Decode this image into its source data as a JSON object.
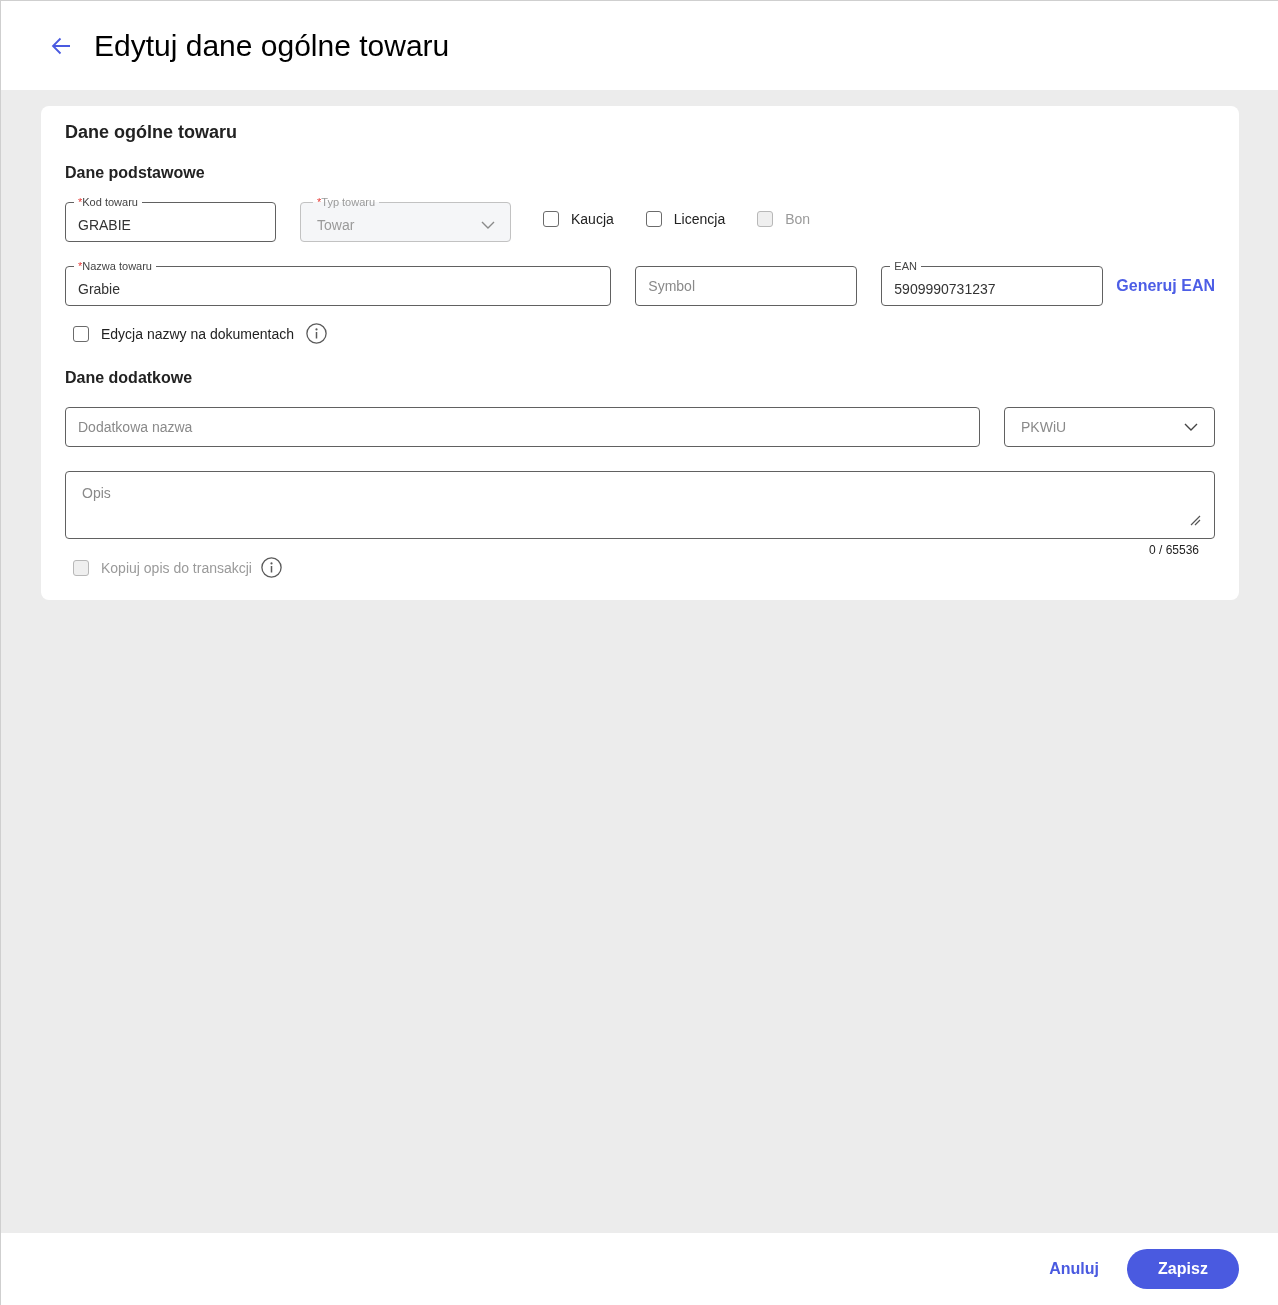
{
  "header": {
    "title": "Edytuj dane ogólne towaru"
  },
  "card": {
    "title": "Dane ogólne towaru",
    "basic": {
      "heading": "Dane podstawowe",
      "code_field": {
        "required_mark": "*",
        "label": "Kod towaru",
        "value": "GRABIE"
      },
      "type_select": {
        "required_mark": "*",
        "label": "Typ towaru",
        "value": "Towar",
        "disabled": true
      },
      "flags": [
        {
          "label": "Kaucja",
          "checked": false,
          "disabled": false
        },
        {
          "label": "Licencja",
          "checked": false,
          "disabled": false
        },
        {
          "label": "Bon",
          "checked": false,
          "disabled": true
        }
      ],
      "name_field": {
        "required_mark": "*",
        "label": "Nazwa towaru",
        "value": "Grabie"
      },
      "symbol_field": {
        "placeholder": "Symbol"
      },
      "ean_field": {
        "label": "EAN",
        "value": "5909990731237"
      },
      "generate_link": "Generuj EAN",
      "name_edit_option": {
        "label": "Edycja nazwy na dokumentach",
        "checked": false,
        "disabled": false
      }
    },
    "additional": {
      "heading": "Dane dodatkowe",
      "extra_name_field": {
        "placeholder": "Dodatkowa nazwa"
      },
      "pkwiu_select": {
        "placeholder": "PKWiU"
      },
      "description": {
        "placeholder": "Opis",
        "counter": "0 / 65536"
      },
      "copy_option": {
        "label": "Kopiuj opis do transakcji",
        "checked": false,
        "disabled": true
      }
    }
  },
  "footer": {
    "buttons": [
      {
        "label": "Anuluj",
        "kind": "text"
      },
      {
        "label": "Zapisz",
        "kind": "primary"
      }
    ]
  }
}
